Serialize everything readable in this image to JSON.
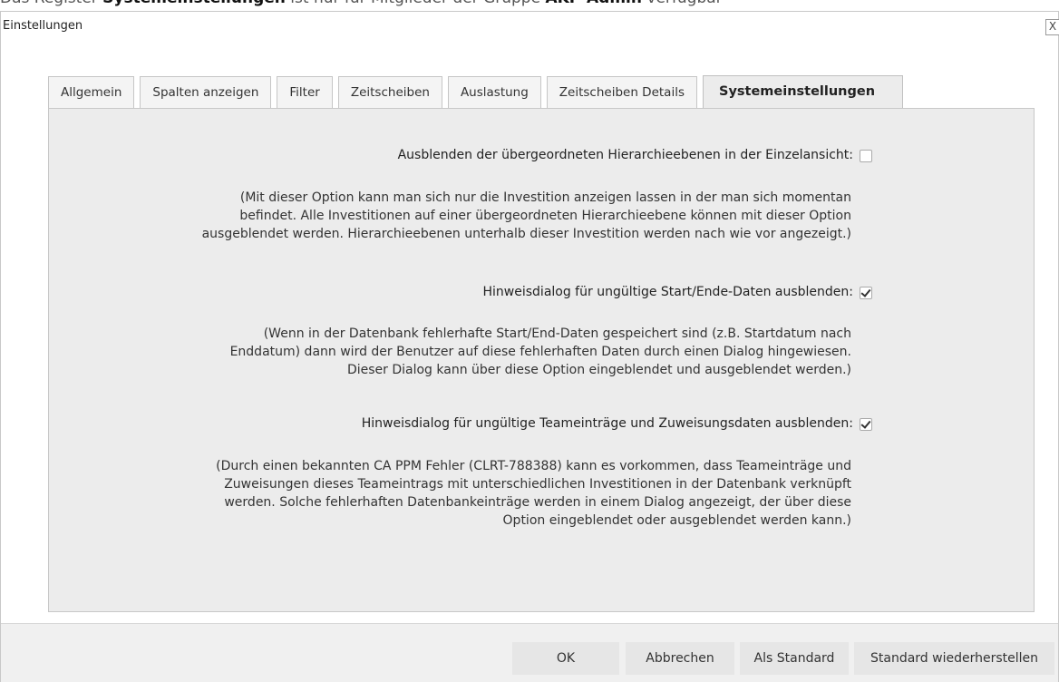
{
  "caption": {
    "prefix": "Das Register ",
    "bold1": "Systemeinstellungen",
    "middle": " ist nur für Mitglieder der Gruppe ",
    "bold2": "AKP-Admin",
    "suffix": " verfügbar"
  },
  "dialog": {
    "title": "Einstellungen",
    "close_label": "X"
  },
  "tabs": [
    {
      "label": "Allgemein"
    },
    {
      "label": "Spalten anzeigen"
    },
    {
      "label": "Filter"
    },
    {
      "label": "Zeitscheiben"
    },
    {
      "label": "Auslastung"
    },
    {
      "label": "Zeitscheiben Details"
    },
    {
      "label": "Systemeinstellungen",
      "active": true
    }
  ],
  "options": [
    {
      "label": "Ausblenden der übergeordneten Hierarchieebenen in der Einzelansicht:",
      "checked": false,
      "description": [
        "(Mit dieser Option kann man sich nur die Investition anzeigen lassen in der man sich momentan",
        "befindet. Alle Investitionen auf einer übergeordneten Hierarchieebene können mit dieser Option",
        "ausgeblendet werden. Hierarchieebenen unterhalb dieser Investition werden nach wie vor angezeigt.)"
      ]
    },
    {
      "label": "Hinweisdialog für ungültige Start/Ende-Daten ausblenden:",
      "checked": true,
      "description": [
        "(Wenn in der Datenbank fehlerhafte Start/End-Daten gespeichert sind (z.B. Startdatum nach",
        "Enddatum) dann wird der Benutzer auf diese fehlerhaften Daten durch einen Dialog hingewiesen.",
        "Dieser Dialog kann über diese Option eingeblendet und ausgeblendet werden.)"
      ]
    },
    {
      "label": "Hinweisdialog für ungültige Teameinträge und Zuweisungsdaten ausblenden:",
      "checked": true,
      "description": [
        "(Durch einen bekannten CA PPM Fehler (CLRT-788388) kann es vorkommen, dass Teameinträge und",
        "Zuweisungen dieses Teameintrags mit unterschiedlichen Investitionen in der Datenbank verknüpft",
        "werden. Solche fehlerhaften Datenbankeinträge werden in einem Dialog angezeigt, der über diese",
        "Option eingeblendet oder ausgeblendet werden kann.)"
      ]
    }
  ],
  "buttons": {
    "ok": "OK",
    "cancel": "Abbrechen",
    "as_default": "Als Standard",
    "restore_default": "Standard wiederherstellen"
  }
}
